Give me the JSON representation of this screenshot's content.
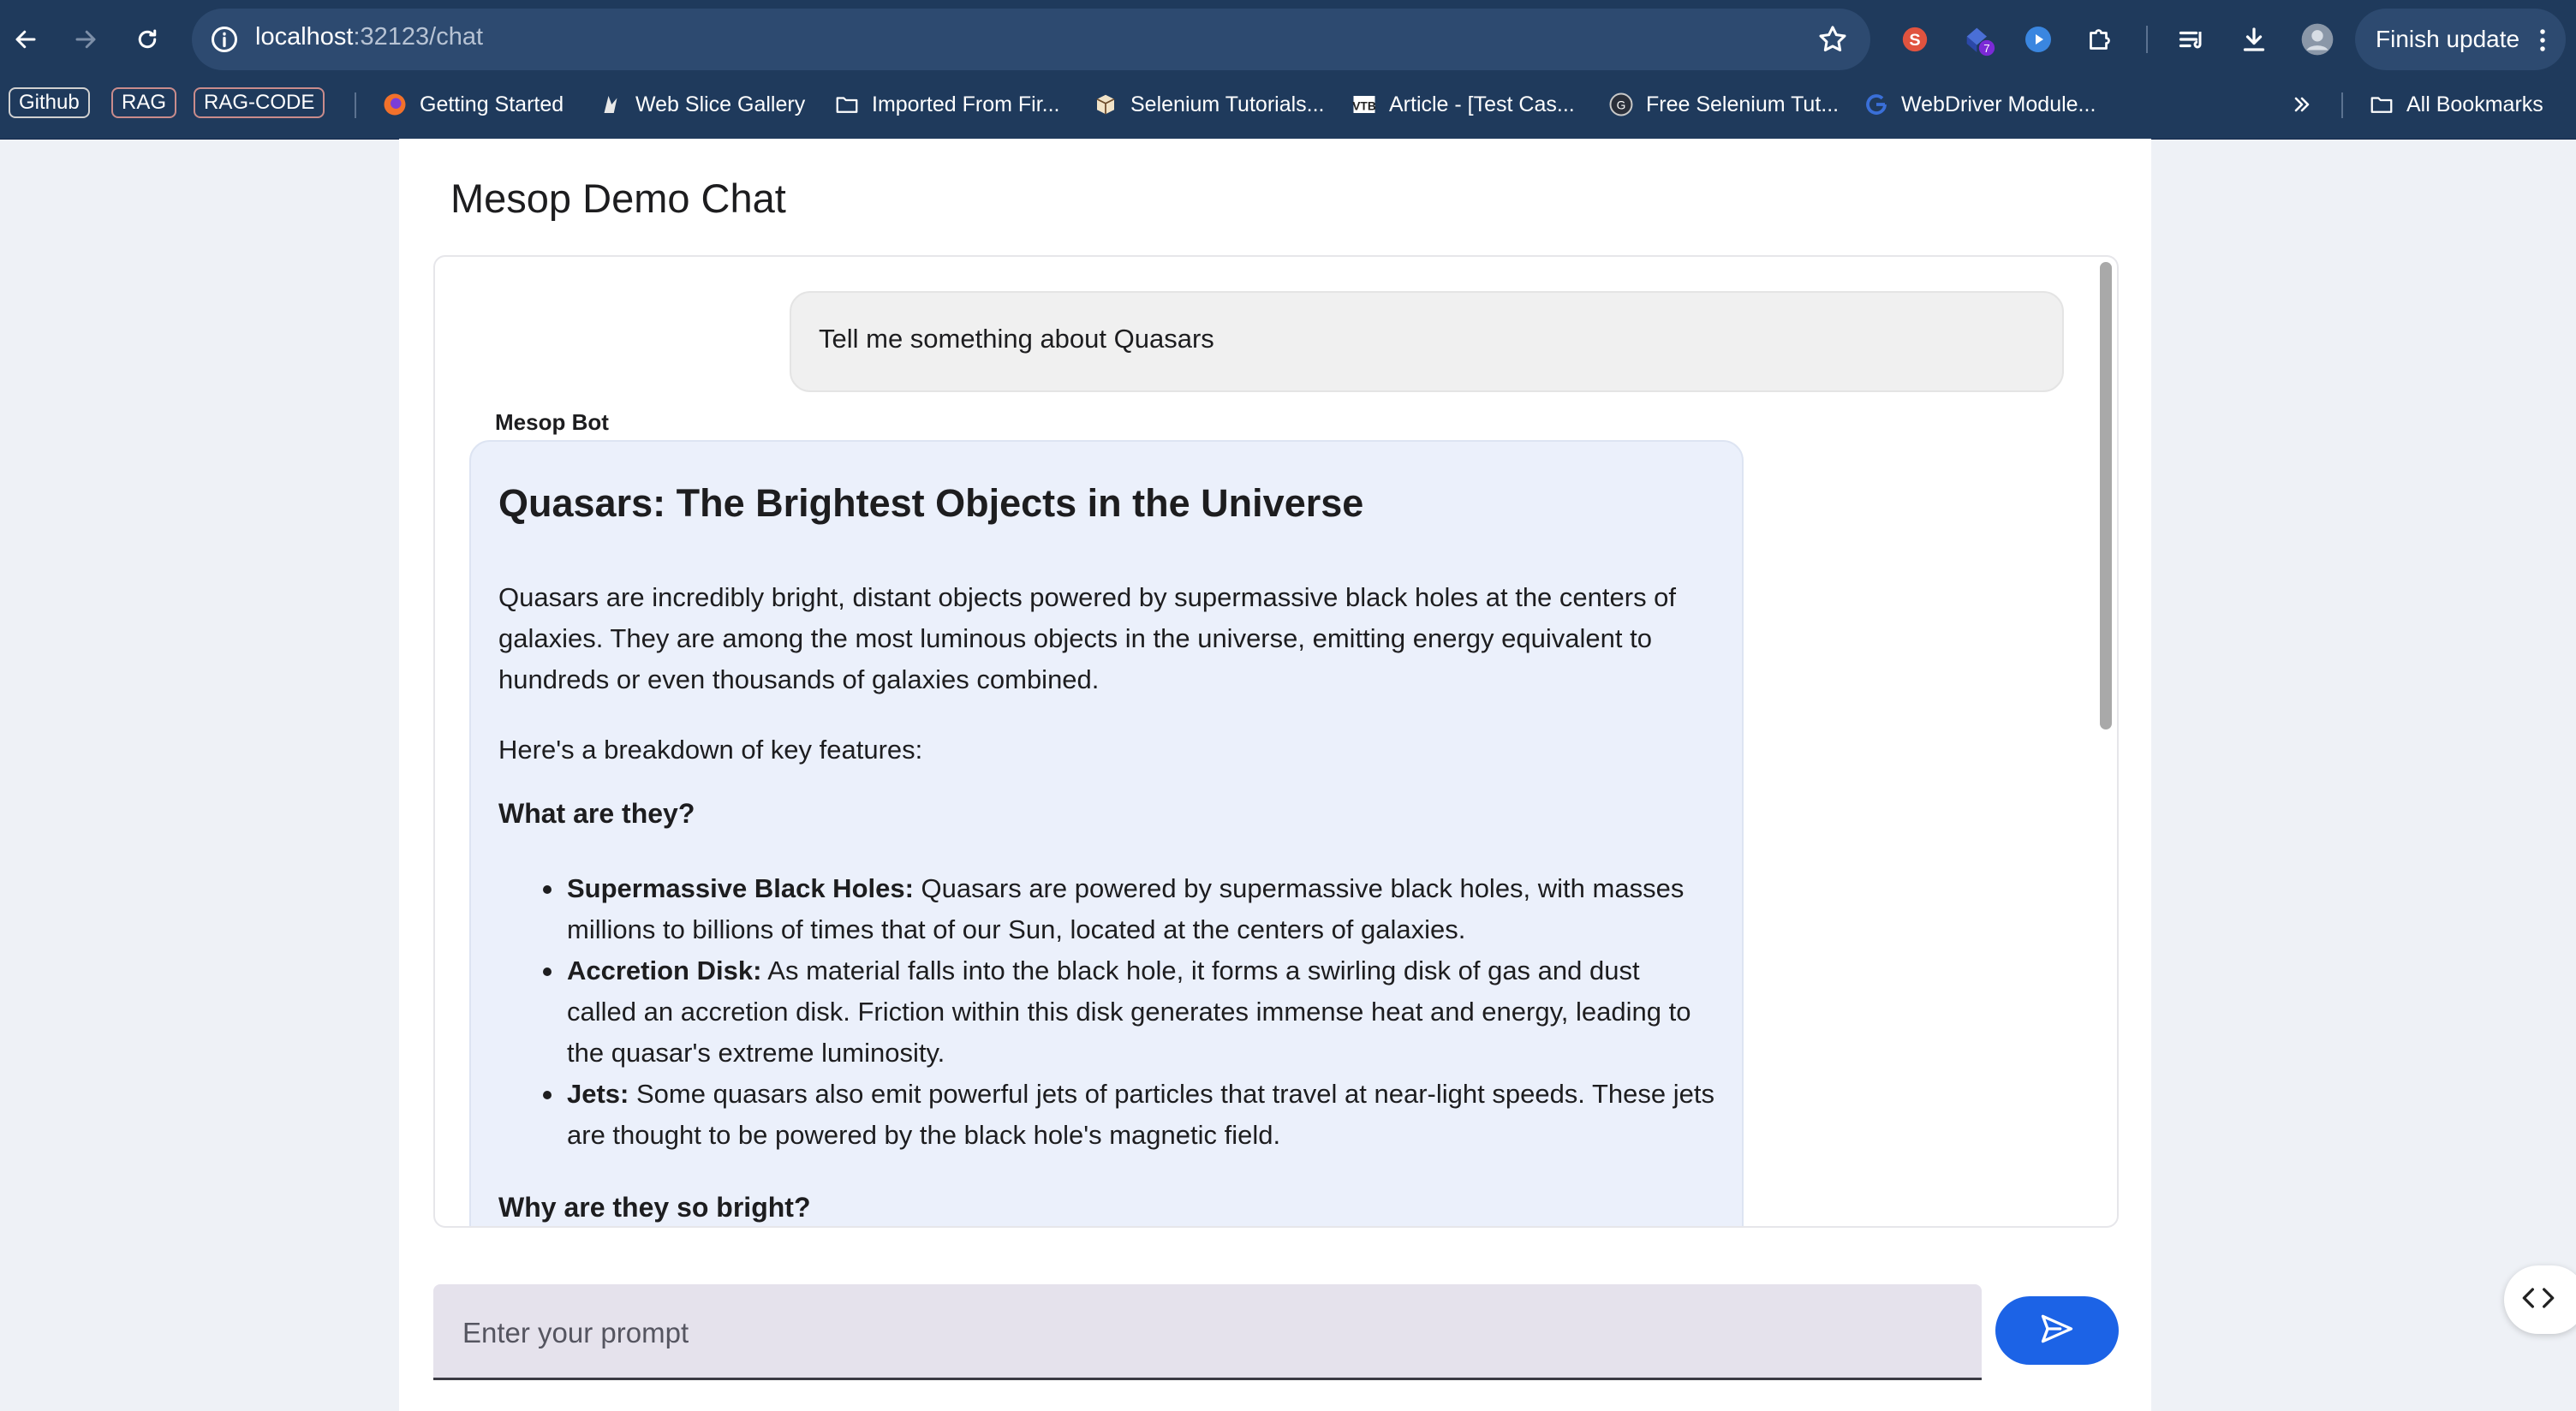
{
  "browser": {
    "url_host": "localhost",
    "url_path": ":32123/chat",
    "finish_update_label": "Finish update",
    "extension_badge": "7"
  },
  "bookmarks": {
    "chips": [
      "Github",
      "RAG",
      "RAG-CODE"
    ],
    "items": [
      {
        "label": "Getting Started",
        "icon": "firefox-icon"
      },
      {
        "label": "Web Slice Gallery",
        "icon": "web-slice-icon"
      },
      {
        "label": "Imported From Fir...",
        "icon": "folder-icon"
      },
      {
        "label": "Selenium Tutorials...",
        "icon": "box-icon"
      },
      {
        "label": "Article - [Test Cas...",
        "icon": "vtb-icon"
      },
      {
        "label": "Free Selenium Tut...",
        "icon": "circle-logo-icon"
      },
      {
        "label": "WebDriver Module...",
        "icon": "google-icon"
      }
    ],
    "all_bookmarks_label": "All Bookmarks"
  },
  "page": {
    "title": "Mesop Demo Chat"
  },
  "chat": {
    "user_message": "Tell me something about Quasars",
    "bot_name": "Mesop Bot",
    "bot_heading": "Quasars: The Brightest Objects in the Universe",
    "bot_para1": "Quasars are incredibly bright, distant objects powered by supermassive black holes at the centers of galaxies. They are among the most luminous objects in the universe, emitting energy equivalent to hundreds or even thousands of galaxies combined.",
    "bot_para2": "Here's a breakdown of key features:",
    "bot_sub1": "What are they?",
    "bullets": [
      {
        "term": "Supermassive Black Holes:",
        "text": " Quasars are powered by supermassive black holes, with masses millions to billions of times that of our Sun, located at the centers of galaxies."
      },
      {
        "term": "Accretion Disk:",
        "text": " As material falls into the black hole, it forms a swirling disk of gas and dust called an accretion disk. Friction within this disk generates immense heat and energy, leading to the quasar's extreme luminosity."
      },
      {
        "term": "Jets:",
        "text": " Some quasars also emit powerful jets of particles that travel at near-light speeds. These jets are thought to be powered by the black hole's magnetic field."
      }
    ],
    "bot_sub2": "Why are they so bright?"
  },
  "input": {
    "placeholder": "Enter your prompt",
    "value": ""
  },
  "colors": {
    "chrome_bg": "#1f3a5c",
    "send_button": "#1c63e6",
    "bot_bubble": "#ebf0fb",
    "user_bubble": "#f0f0f0"
  }
}
